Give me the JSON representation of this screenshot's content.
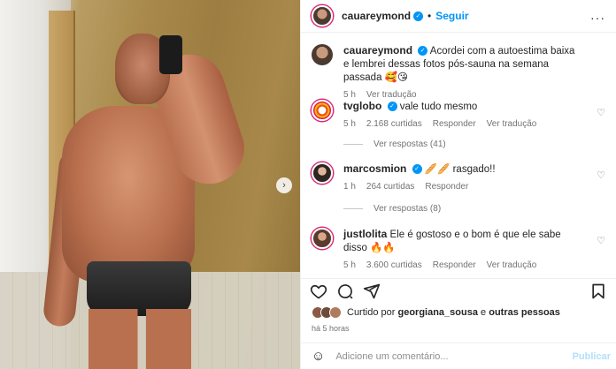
{
  "post": {
    "author": "cauareymond",
    "follow_label": "Seguir",
    "more_icon": "ellipsis-icon"
  },
  "caption": {
    "author": "cauareymond",
    "text": "Acordei com a autoestima baixa e lembrei dessas fotos pós-sauna na semana passada 🥰😘",
    "time": "5 h",
    "translate": "Ver tradução"
  },
  "comments": [
    {
      "author": "tvglobo",
      "verified": true,
      "text": "vale tudo mesmo",
      "time": "5 h",
      "likes": "2.168 curtidas",
      "reply": "Responder",
      "translate": "Ver tradução",
      "view_replies": "Ver respostas (41)"
    },
    {
      "author": "marcosmion",
      "verified": true,
      "text": "🥖🥖 rasgado!!",
      "time": "1 h",
      "likes": "264 curtidas",
      "reply": "Responder",
      "view_replies": "Ver respostas (8)"
    },
    {
      "author": "justlolita",
      "verified": false,
      "text": "Ele é gostoso e o bom é que ele sabe disso 🔥🔥",
      "time": "5 h",
      "likes": "3.600 curtidas",
      "reply": "Responder",
      "translate": "Ver tradução"
    }
  ],
  "likes_summary": {
    "prefix": "Curtido por",
    "user": "georgiana_sousa",
    "joiner": "e",
    "others": "outras pessoas"
  },
  "time_ago": "há 5 horas",
  "comment_box": {
    "placeholder": "Adicione um comentário...",
    "publish": "Publicar"
  },
  "colors": {
    "accent": "#0095f6",
    "story_ring": "#d62976"
  }
}
